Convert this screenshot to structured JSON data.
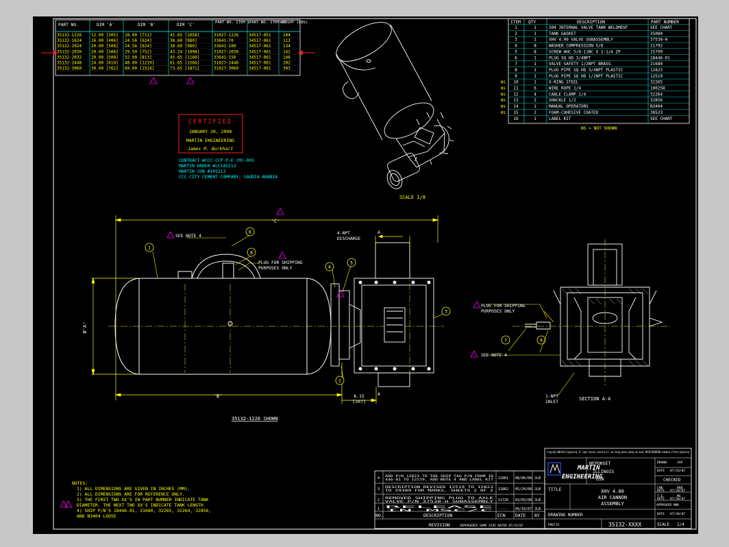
{
  "colors": {
    "background": "#000000",
    "frame": "#c7c7c7",
    "border": "#ffffff",
    "cyan": "#00ffff",
    "yellow": "#ffff00",
    "white": "#ffffff",
    "red": "#ff2020",
    "magenta": "#ff00ff",
    "green": "#00ff00",
    "blue": "#3050ff"
  },
  "part_table": {
    "headers": [
      "PART NO.",
      "DIM 'A'",
      "DIM 'B'",
      "DIM 'C'",
      "PART NO. ITEM 1",
      "PART NO. ITEM 16",
      "WEIGHT (LBS)"
    ],
    "rows": [
      [
        "35132-1226",
        "12.00 [305]",
        "28.00 [711]",
        "41.65 [1058]",
        "31027-1226",
        "34517-051",
        "104"
      ],
      [
        "35132-1624",
        "16.00 [406]",
        "24.56 [624]",
        "38.60 [980]",
        "33641-70",
        "34517-061",
        "112"
      ],
      [
        "35132-2024",
        "20.00 [508]",
        "24.56 [624]",
        "38.60 [980]",
        "33641-100",
        "34517-061",
        "134"
      ],
      [
        "35132-2030",
        "20.00 [508]",
        "29.59 [752]",
        "43.24 [1098]",
        "31027-2030",
        "34517-061",
        "142"
      ],
      [
        "35132-2032",
        "20.00 [508]",
        "32.00 [813]",
        "45.65 [1160]",
        "33641-150",
        "34517-061",
        "146"
      ],
      [
        "35132-2448",
        "24.00 [610]",
        "48.00 [1219]",
        "61.65 [1566]",
        "31027-2448",
        "34517-061",
        "202"
      ],
      [
        "35132-3060",
        "30.00 [762]",
        "60.00 [1524]",
        "73.65 [1871]",
        "31027-3060",
        "34517-061",
        "303"
      ]
    ]
  },
  "bom": {
    "headers": [
      "ITEM",
      "QTY",
      "DESCRIPTION",
      "PART NUMBER"
    ],
    "rows": [
      [
        "",
        "1",
        "1",
        "304 INTERNAL VALVE TANK WELDMENT",
        "SEE CHART"
      ],
      [
        "",
        "2",
        "1",
        "TANK GASKET",
        "35080"
      ],
      [
        "",
        "3",
        "1",
        "XHV 4.00 VALVE SUBASSEMBLY",
        "37538-H"
      ],
      [
        "",
        "4",
        "8",
        "WASHER COMPRESSION 5/8",
        "11792"
      ],
      [
        "",
        "5",
        "8",
        "SCREW HHC 5/8-11NC X 1-1/4 ZP",
        "15799"
      ],
      [
        "",
        "6",
        "1",
        "PLUG SQ HD 3/4NPT",
        "18446-01"
      ],
      [
        "",
        "7",
        "1",
        "VALVE SAFETY 1/2NPT BRASS",
        "21680"
      ],
      [
        "",
        "8",
        "1",
        "PLUG PIPE SQ HD 3/4NPT PLASTIC",
        "12823"
      ],
      [
        "",
        "9",
        "1",
        "PLUG PIPE SQ HD 1/2NPT PLASTIC",
        "12519"
      ],
      [
        "NS",
        "10",
        "1",
        "O-RING STEEL",
        "32265"
      ],
      [
        "NS",
        "11",
        "6",
        "WIRE ROPE 1/4",
        "100258"
      ],
      [
        "NS",
        "12",
        "4",
        "CABLE CLAMP 1/4",
        "32264"
      ],
      [
        "NS",
        "13",
        "2",
        "SHACKLE 1/2",
        "32856"
      ],
      [
        "NS",
        "14",
        "1",
        "MANUAL OPERATORS",
        "N3404"
      ],
      [
        "NS",
        "15",
        "2",
        "FOAM-COHESIVE COATED",
        "38523"
      ],
      [
        "",
        "16",
        "1",
        "LABEL KIT",
        "SEE CHART"
      ]
    ],
    "footnote": "NS = NOT SHOWN"
  },
  "certified": {
    "title": "CERTIFIED",
    "date": "JANUARY 20, 2008",
    "company": "MARTIN ENGINEERING",
    "signature": "James R. Burkhart"
  },
  "contract": [
    "CONTRACT #CCC-CCP-P-E (M)-003",
    "MARTIN ORDER #LC105213",
    "MARTIN JOB #105213",
    "CCC CITY CEMENT COMPANY, SAUDIA ARABIA"
  ],
  "iso_scale": "SCALE 1/8",
  "main_view": {
    "dim_c": "'C'",
    "dim_b": "'B'",
    "dim_a": "Ø'A'",
    "dim_835": "8.15",
    "dim_835b": "[207]",
    "see_note": "SEE NOTE 4",
    "plug_note": [
      "PLUG FOR SHIPPING",
      "PURPOSES ONLY"
    ],
    "discharge": [
      "4-NPT",
      "DISCHARGE"
    ],
    "section_mark": "A",
    "shown": "35132-1226 SHOWN",
    "balloons": [
      "1",
      "2",
      "3",
      "4",
      "5",
      "6",
      "8"
    ]
  },
  "section_view": {
    "title": "SECTION A-A",
    "inlet": [
      "1-NPT",
      "INLET"
    ],
    "plug_note": [
      "PLUG FOR SHIPPING",
      "PURPOSES ONLY"
    ],
    "see_note": "SEE NOTE 4",
    "balloons": [
      "7",
      "9"
    ]
  },
  "notes": {
    "title": "NOTES:",
    "items": [
      "1) ALL DIMENSIONS ARE GIVEN IN INCHES (MM).",
      "2) ALL DIMENSIONS ARE FOR REFERENCE ONLY.",
      "3) THE FIRST TWO XX'S IN PART NUMBER INDICATE TANK",
      "   DIAMETER. THE NEXT TWO XX'S INDICATE TANK LENGTH",
      "4) SHIP P/N'S 18446-01, 21680, 32265, 32264, 32856,",
      "   AND N3404 LOOSE"
    ]
  },
  "revisions": {
    "rows": [
      {
        "no": "4",
        "desc": "ADD P/N 12823 TO THE SHIP TAG P/N FROM 18446-01 TO 12519, ADD NOTE 4 AND LABEL KIT",
        "ecn": "11861",
        "date": "08/06/08",
        "by": "JLB"
      },
      {
        "no": "3",
        "desc": "DESCRIPTION REVISED 12519 TO 12823 TO 29389 FOR MARKS, SHEETS 2 OF 2",
        "ecn": "11862",
        "date": "05/20/08",
        "by": "JLB"
      },
      {
        "no": "2",
        "desc": "REMOVED SHIPPING PLUG TO AXLE VALVE P/N 37538-H SUBASSEMBLY",
        "ecn": "11728",
        "date": "03/03/08",
        "by": "JLB"
      },
      {
        "no": "1",
        "desc": "RELEASE IN MSC/C",
        "ecn": "-----",
        "date": "09/10/07",
        "by": "JLB"
      }
    ],
    "header": {
      "no": "NO.",
      "desc": "DESCRIPTION",
      "ecn": "ECN",
      "date": "DATE",
      "by": "BY"
    },
    "footer": "REVISION",
    "supersedes": "SUPERSEDES SAME SIZE DATED 07/31/07"
  },
  "title_block": {
    "copyright": "© Copyright 2008 Martin Engineering. All rights reserved. Covered by U.S. and foreign patents pending and issued. MARTIN ENGINEERING trademarks of Martin Engineering",
    "company_line1": "MARTIN",
    "company_line2": "ENGINEERING",
    "address": [
      "NEPONSET",
      "ILLINOIS",
      "USA"
    ],
    "title_label": "TITLE",
    "title": [
      "XHV 4.00",
      "AIR CANNON",
      "ASSEMBLY"
    ],
    "drawing_number_label": "DRAWING NUMBER",
    "drawing_number": "35132-XXXX",
    "prefix": "PREFIX",
    "scale_label": "SCALE",
    "scale_value": "1/4",
    "drawn": "DRAWN",
    "drawn_by": "JAP",
    "drawn_date_label": "DATE",
    "drawn_date": "07/26/07",
    "checked": "CHECKED",
    "chk_label": "CHK",
    "chk_by": "RRB",
    "chk_date_label": "DATE",
    "chk_date": "07/30/07",
    "te_label": "T.E.",
    "te_by": "MG",
    "te_date_label": "DATE",
    "te_date": "07/30/07",
    "approved": "APPROVED MKK",
    "appr_date_label": "DATE",
    "appr_date": "07/30/07"
  }
}
